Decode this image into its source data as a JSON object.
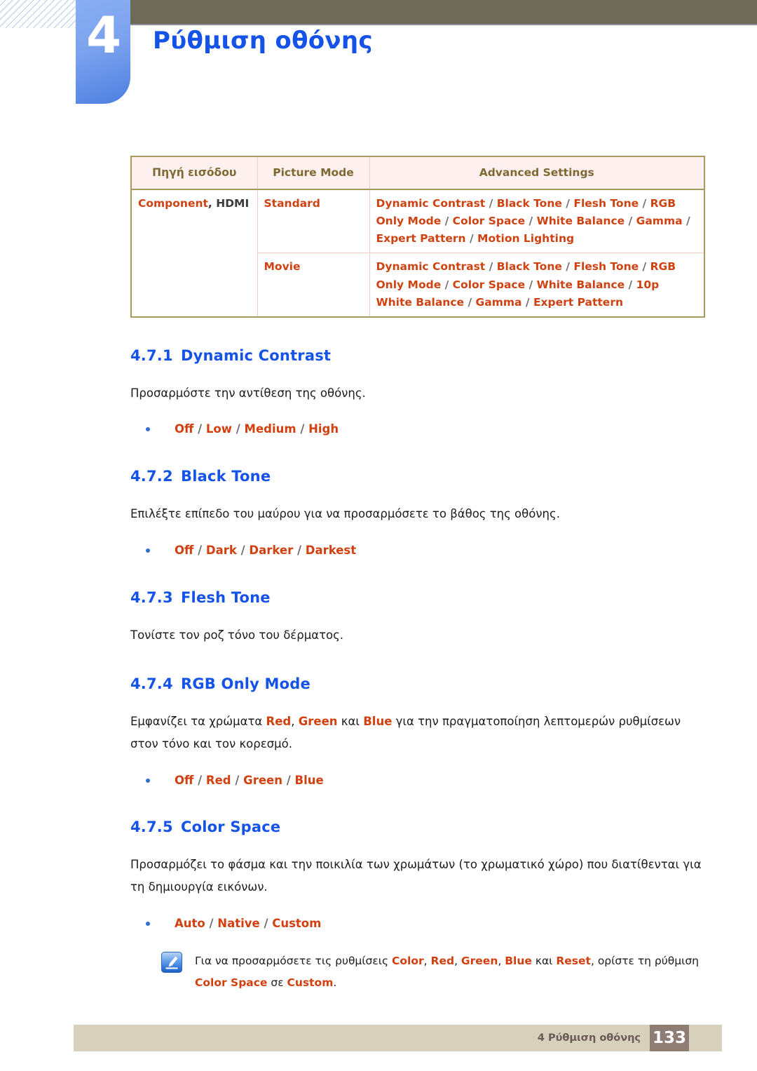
{
  "header": {
    "chapter_number": "4",
    "chapter_title": "Ρύθμιση οθόνης"
  },
  "table": {
    "headers": [
      "Πηγή εισόδου",
      "Picture Mode",
      "Advanced Settings"
    ],
    "source_prefix": "Component",
    "source_comma": ", ",
    "source_suffix": "HDMI",
    "rows": [
      {
        "mode": "Standard",
        "advanced": "Dynamic Contrast / Black Tone / Flesh Tone / RGB Only Mode / Color Space / White Balance / Gamma / Expert Pattern / Motion Lighting"
      },
      {
        "mode": "Movie",
        "advanced": "Dynamic Contrast / Black Tone / Flesh Tone / RGB Only Mode / Color Space / White Balance / 10p White Balance / Gamma / Expert Pattern"
      }
    ]
  },
  "sections": [
    {
      "number": "4.7.1",
      "title": "Dynamic Contrast",
      "body": "Προσαρμόστε την αντίθεση της οθόνης.",
      "options": "Off / Low / Medium / High"
    },
    {
      "number": "4.7.2",
      "title": "Black Tone",
      "body": "Επιλέξτε επίπεδο του μαύρου για να προσαρμόσετε το βάθος της οθόνης.",
      "options": "Off / Dark / Darker / Darkest"
    },
    {
      "number": "4.7.3",
      "title": "Flesh Tone",
      "body": "Τονίστε τον ροζ τόνο του δέρματος.",
      "options": ""
    },
    {
      "number": "4.7.4",
      "title": "RGB Only Mode",
      "body_pre": "Εμφανίζει τα χρώματα ",
      "body_hl1": "Red",
      "body_mid1": ", ",
      "body_hl2": "Green",
      "body_mid2": " και ",
      "body_hl3": "Blue",
      "body_post": " για την πραγματοποίηση λεπτομερών ρυθμίσεων στον τόνο και τον κορεσμό.",
      "options": "Off / Red / Green / Blue"
    },
    {
      "number": "4.7.5",
      "title": "Color Space",
      "body": "Προσαρμόζει το φάσμα και την ποικιλία των χρωμάτων (το χρωματικό χώρο) που διατίθενται για τη δημιουργία εικόνων.",
      "options": "Auto / Native / Custom"
    }
  ],
  "note": {
    "icon_name": "note-pen-icon",
    "pre": "Για να προσαρμόσετε τις ρυθμίσεις ",
    "hl1": "Color",
    "mid1": ", ",
    "hl2": "Red",
    "mid2": ", ",
    "hl3": "Green",
    "mid3": ", ",
    "hl4": "Blue",
    "mid4": " και ",
    "hl5": "Reset",
    "mid5": ", ορίστε τη ρύθμιση ",
    "hl6": "Color Space",
    "mid6": " σε ",
    "hl7": "Custom",
    "post": "."
  },
  "footer": {
    "label": "4 Ρύθμιση οθόνης",
    "page_number": "133"
  },
  "colors": {
    "accent_blue": "#1553e8",
    "accent_orange": "#d2400f",
    "table_border": "#a89a5e",
    "table_header_bg": "#fdf0ee",
    "olive_bar": "#6d6b57",
    "footer_bg": "#d6d0bd",
    "footer_page_bg": "#8d7d75"
  }
}
